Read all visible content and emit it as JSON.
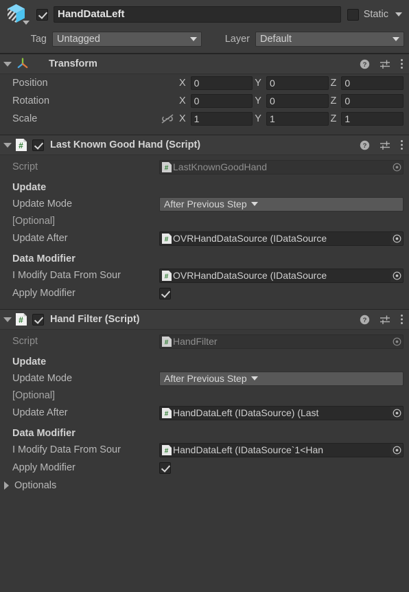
{
  "gameobject": {
    "icon": "cube-icon",
    "enabled": true,
    "name": "HandDataLeft",
    "static_checked": false,
    "static_label": "Static",
    "tag_label": "Tag",
    "tag_value": "Untagged",
    "layer_label": "Layer",
    "layer_value": "Default"
  },
  "transform": {
    "title": "Transform",
    "icon": "transform-axis-icon",
    "expanded": true,
    "rows": [
      {
        "label": "Position",
        "x": "0",
        "y": "0",
        "z": "0"
      },
      {
        "label": "Rotation",
        "x": "0",
        "y": "0",
        "z": "0"
      },
      {
        "label": "Scale",
        "x": "1",
        "y": "1",
        "z": "1",
        "link_icon": "link-broken-icon"
      }
    ],
    "axis_x": "X",
    "axis_y": "Y",
    "axis_z": "Z"
  },
  "components": [
    {
      "title": "Last Known Good Hand (Script)",
      "icon": "script-icon",
      "enabled": true,
      "expanded": true,
      "script_label": "Script",
      "script_value": "LastKnownGoodHand",
      "update_header": "Update",
      "update_mode_label": "Update Mode",
      "update_mode_value": "After Previous Step",
      "optional_tag": "[Optional]",
      "update_after_label": "Update After",
      "update_after_value": "OVRHandDataSource (IDataSource",
      "data_modifier_header": "Data Modifier",
      "modify_source_label": "I Modify Data From Sour",
      "modify_source_value": "OVRHandDataSource (IDataSource",
      "apply_modifier_label": "Apply Modifier",
      "apply_modifier_checked": true,
      "has_optionals": false,
      "optionals_label": ""
    },
    {
      "title": "Hand Filter (Script)",
      "icon": "script-icon",
      "enabled": true,
      "expanded": true,
      "script_label": "Script",
      "script_value": "HandFilter",
      "update_header": "Update",
      "update_mode_label": "Update Mode",
      "update_mode_value": "After Previous Step",
      "optional_tag": "[Optional]",
      "update_after_label": "Update After",
      "update_after_value": "HandDataLeft (IDataSource) (Last",
      "data_modifier_header": "Data Modifier",
      "modify_source_label": "I Modify Data From Sour",
      "modify_source_value": "HandDataLeft (IDataSource`1<Han",
      "apply_modifier_label": "Apply Modifier",
      "apply_modifier_checked": true,
      "has_optionals": true,
      "optionals_label": "Optionals"
    }
  ],
  "header_icons": {
    "help": "help-icon",
    "preset": "preset-icon",
    "menu": "kebab-menu-icon"
  },
  "colors": {
    "background": "#383838",
    "header_bg": "#3c3c3c",
    "field_bg": "#2a2a2a",
    "dropdown_bg": "#585858",
    "text": "#c4c4c4",
    "cube_blue": "#4cc3f0",
    "script_green": "#2e7d32"
  }
}
